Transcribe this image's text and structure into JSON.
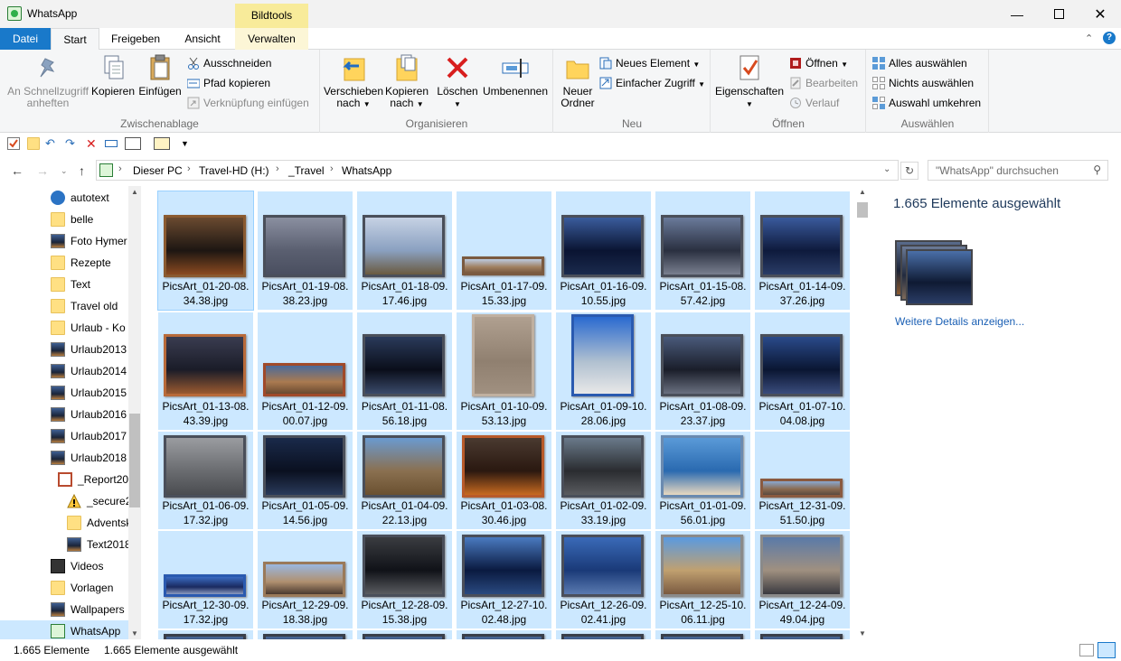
{
  "window": {
    "title": "WhatsApp",
    "context_tab_header": "Bildtools"
  },
  "tabs": [
    {
      "label": "Datei"
    },
    {
      "label": "Start"
    },
    {
      "label": "Freigeben"
    },
    {
      "label": "Ansicht"
    },
    {
      "label": "Verwalten"
    }
  ],
  "ribbon": {
    "clipboard": {
      "group": "Zwischenablage",
      "pin_line1": "An Schnellzugriff",
      "pin_line2": "anheften",
      "copy": "Kopieren",
      "paste": "Einfügen",
      "cut": "Ausschneiden",
      "copy_path": "Pfad kopieren",
      "paste_shortcut": "Verknüpfung einfügen"
    },
    "organize": {
      "group": "Organisieren",
      "move_line1": "Verschieben",
      "move_line2": "nach",
      "copyto_line1": "Kopieren",
      "copyto_line2": "nach",
      "delete": "Löschen",
      "rename": "Umbenennen"
    },
    "new": {
      "group": "Neu",
      "folder_line1": "Neuer",
      "folder_line2": "Ordner",
      "new_item": "Neues Element",
      "easy_access": "Einfacher Zugriff"
    },
    "open": {
      "group": "Öffnen",
      "properties": "Eigenschaften",
      "open": "Öffnen",
      "edit": "Bearbeiten",
      "history": "Verlauf"
    },
    "select": {
      "group": "Auswählen",
      "select_all": "Alles auswählen",
      "select_none": "Nichts auswählen",
      "invert": "Auswahl umkehren"
    }
  },
  "address": {
    "crumbs": [
      "Dieser PC",
      "Travel-HD (H:)",
      "_Travel",
      "WhatsApp"
    ],
    "search_placeholder": "\"WhatsApp\" durchsuchen"
  },
  "nav": [
    {
      "label": "autotext",
      "icon": "onedrive-icon"
    },
    {
      "label": "belle",
      "icon": "folder-icon"
    },
    {
      "label": "Foto Hymer",
      "icon": "image-folder-icon"
    },
    {
      "label": "Rezepte",
      "icon": "folder-icon"
    },
    {
      "label": "Text",
      "icon": "folder-icon"
    },
    {
      "label": "Travel old",
      "icon": "folder-icon"
    },
    {
      "label": "Urlaub - Ko",
      "icon": "folder-icon"
    },
    {
      "label": "Urlaub2013",
      "icon": "image-folder-icon"
    },
    {
      "label": "Urlaub2014",
      "icon": "image-folder-icon"
    },
    {
      "label": "Urlaub2015",
      "icon": "image-folder-icon"
    },
    {
      "label": "Urlaub2016",
      "icon": "image-folder-icon"
    },
    {
      "label": "Urlaub2017",
      "icon": "image-folder-icon"
    },
    {
      "label": "Urlaub2018",
      "icon": "image-folder-icon"
    },
    {
      "label": "_Report20",
      "icon": "report-icon"
    },
    {
      "label": "_secure2",
      "icon": "warning-icon"
    },
    {
      "label": "Adventsk",
      "icon": "folder-icon"
    },
    {
      "label": "Text2018",
      "icon": "image-folder-icon"
    },
    {
      "label": "Videos",
      "icon": "videos-icon"
    },
    {
      "label": "Vorlagen",
      "icon": "folder-icon"
    },
    {
      "label": "Wallpapers",
      "icon": "image-folder-icon"
    },
    {
      "label": "WhatsApp",
      "icon": "whatsapp-icon"
    }
  ],
  "files": [
    {
      "line1": "PicsArt_01-20-08.",
      "line2": "34.38.jpg"
    },
    {
      "line1": "PicsArt_01-19-08.",
      "line2": "38.23.jpg"
    },
    {
      "line1": "PicsArt_01-18-09.",
      "line2": "17.46.jpg"
    },
    {
      "line1": "PicsArt_01-17-09.",
      "line2": "15.33.jpg"
    },
    {
      "line1": "PicsArt_01-16-09.",
      "line2": "10.55.jpg"
    },
    {
      "line1": "PicsArt_01-15-08.",
      "line2": "57.42.jpg"
    },
    {
      "line1": "PicsArt_01-14-09.",
      "line2": "37.26.jpg"
    },
    {
      "line1": "PicsArt_01-13-08.",
      "line2": "43.39.jpg"
    },
    {
      "line1": "PicsArt_01-12-09.",
      "line2": "00.07.jpg"
    },
    {
      "line1": "PicsArt_01-11-08.",
      "line2": "56.18.jpg"
    },
    {
      "line1": "PicsArt_01-10-09.",
      "line2": "53.13.jpg"
    },
    {
      "line1": "PicsArt_01-09-10.",
      "line2": "28.06.jpg"
    },
    {
      "line1": "PicsArt_01-08-09.",
      "line2": "23.37.jpg"
    },
    {
      "line1": "PicsArt_01-07-10.",
      "line2": "04.08.jpg"
    },
    {
      "line1": "PicsArt_01-06-09.",
      "line2": "17.32.jpg"
    },
    {
      "line1": "PicsArt_01-05-09.",
      "line2": "14.56.jpg"
    },
    {
      "line1": "PicsArt_01-04-09.",
      "line2": "22.13.jpg"
    },
    {
      "line1": "PicsArt_01-03-08.",
      "line2": "30.46.jpg"
    },
    {
      "line1": "PicsArt_01-02-09.",
      "line2": "33.19.jpg"
    },
    {
      "line1": "PicsArt_01-01-09.",
      "line2": "56.01.jpg"
    },
    {
      "line1": "PicsArt_12-31-09.",
      "line2": "51.50.jpg"
    },
    {
      "line1": "PicsArt_12-30-09.",
      "line2": "17.32.jpg"
    },
    {
      "line1": "PicsArt_12-29-09.",
      "line2": "18.38.jpg"
    },
    {
      "line1": "PicsArt_12-28-09.",
      "line2": "15.38.jpg"
    },
    {
      "line1": "PicsArt_12-27-10.",
      "line2": "02.48.jpg"
    },
    {
      "line1": "PicsArt_12-26-09.",
      "line2": "02.41.jpg"
    },
    {
      "line1": "PicsArt_12-25-10.",
      "line2": "06.11.jpg"
    },
    {
      "line1": "PicsArt_12-24-09.",
      "line2": "49.04.jpg"
    }
  ],
  "details": {
    "heading": "1.665 Elemente ausgewählt",
    "more": "Weitere Details anzeigen..."
  },
  "status": {
    "count": "1.665 Elemente",
    "selected": "1.665 Elemente ausgewählt"
  },
  "colors": {
    "accent": "#1979ca",
    "selection": "#cce8ff",
    "context_tab": "#f8eb9a"
  }
}
